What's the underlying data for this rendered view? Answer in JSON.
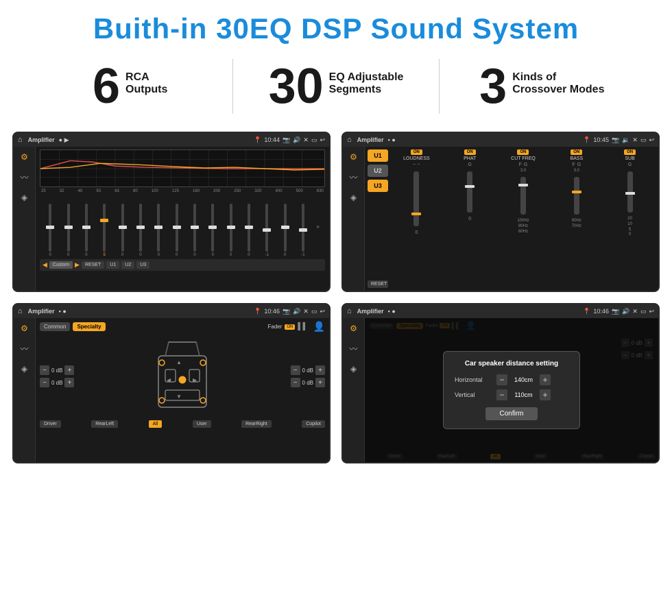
{
  "header": {
    "title": "Buith-in 30EQ DSP Sound System"
  },
  "stats": [
    {
      "number": "6",
      "line1": "RCA",
      "line2": "Outputs"
    },
    {
      "number": "30",
      "line1": "EQ Adjustable",
      "line2": "Segments"
    },
    {
      "number": "3",
      "line1": "Kinds of",
      "line2": "Crossover Modes"
    }
  ],
  "screens": [
    {
      "id": "screen1",
      "topbar": {
        "title": "Amplifier",
        "time": "10:44"
      },
      "type": "eq"
    },
    {
      "id": "screen2",
      "topbar": {
        "title": "Amplifier",
        "time": "10:45"
      },
      "type": "amp2"
    },
    {
      "id": "screen3",
      "topbar": {
        "title": "Amplifier",
        "time": "10:46"
      },
      "type": "speaker"
    },
    {
      "id": "screen4",
      "topbar": {
        "title": "Amplifier",
        "time": "10:46"
      },
      "type": "dialog"
    }
  ],
  "eq": {
    "freqs": [
      "25",
      "32",
      "40",
      "50",
      "63",
      "80",
      "100",
      "125",
      "160",
      "200",
      "250",
      "320",
      "400",
      "500",
      "630"
    ],
    "vals": [
      "0",
      "0",
      "0",
      "5",
      "0",
      "0",
      "0",
      "0",
      "0",
      "0",
      "0",
      "0",
      "-1",
      "0",
      "-1"
    ],
    "presets": [
      "Custom",
      "RESET",
      "U1",
      "U2",
      "U3"
    ]
  },
  "amp2": {
    "users": [
      "U1",
      "U2",
      "U3"
    ],
    "channels": [
      {
        "label": "LOUDNESS",
        "on": true,
        "thumbPos": 60
      },
      {
        "label": "PHAT",
        "on": true,
        "thumbPos": 40
      },
      {
        "label": "CUT FREQ",
        "on": true,
        "thumbPos": 50
      },
      {
        "label": "BASS",
        "on": true,
        "thumbPos": 55
      },
      {
        "label": "SUB",
        "on": true,
        "thumbPos": 45
      }
    ],
    "resetLabel": "RESET"
  },
  "speaker": {
    "tabs": [
      "Common",
      "Specialty"
    ],
    "activeTab": "Specialty",
    "faderLabel": "Fader",
    "channels": [
      {
        "label": "0 dB"
      },
      {
        "label": "0 dB"
      },
      {
        "label": "0 dB"
      },
      {
        "label": "0 dB"
      }
    ],
    "buttons": [
      "Driver",
      "All",
      "RearLeft",
      "User",
      "RearRight",
      "Copilot"
    ]
  },
  "dialog": {
    "title": "Car speaker distance setting",
    "horizontal": {
      "label": "Horizontal",
      "value": "140cm"
    },
    "vertical": {
      "label": "Vertical",
      "value": "110cm"
    },
    "confirmLabel": "Confirm",
    "tabs": [
      "Common",
      "Specialty"
    ],
    "rightSide": {
      "db1": "0 dB",
      "db2": "0 dB"
    },
    "buttons": [
      "Driver",
      "RearLeft",
      "User",
      "RearRight",
      "Copilot"
    ]
  }
}
